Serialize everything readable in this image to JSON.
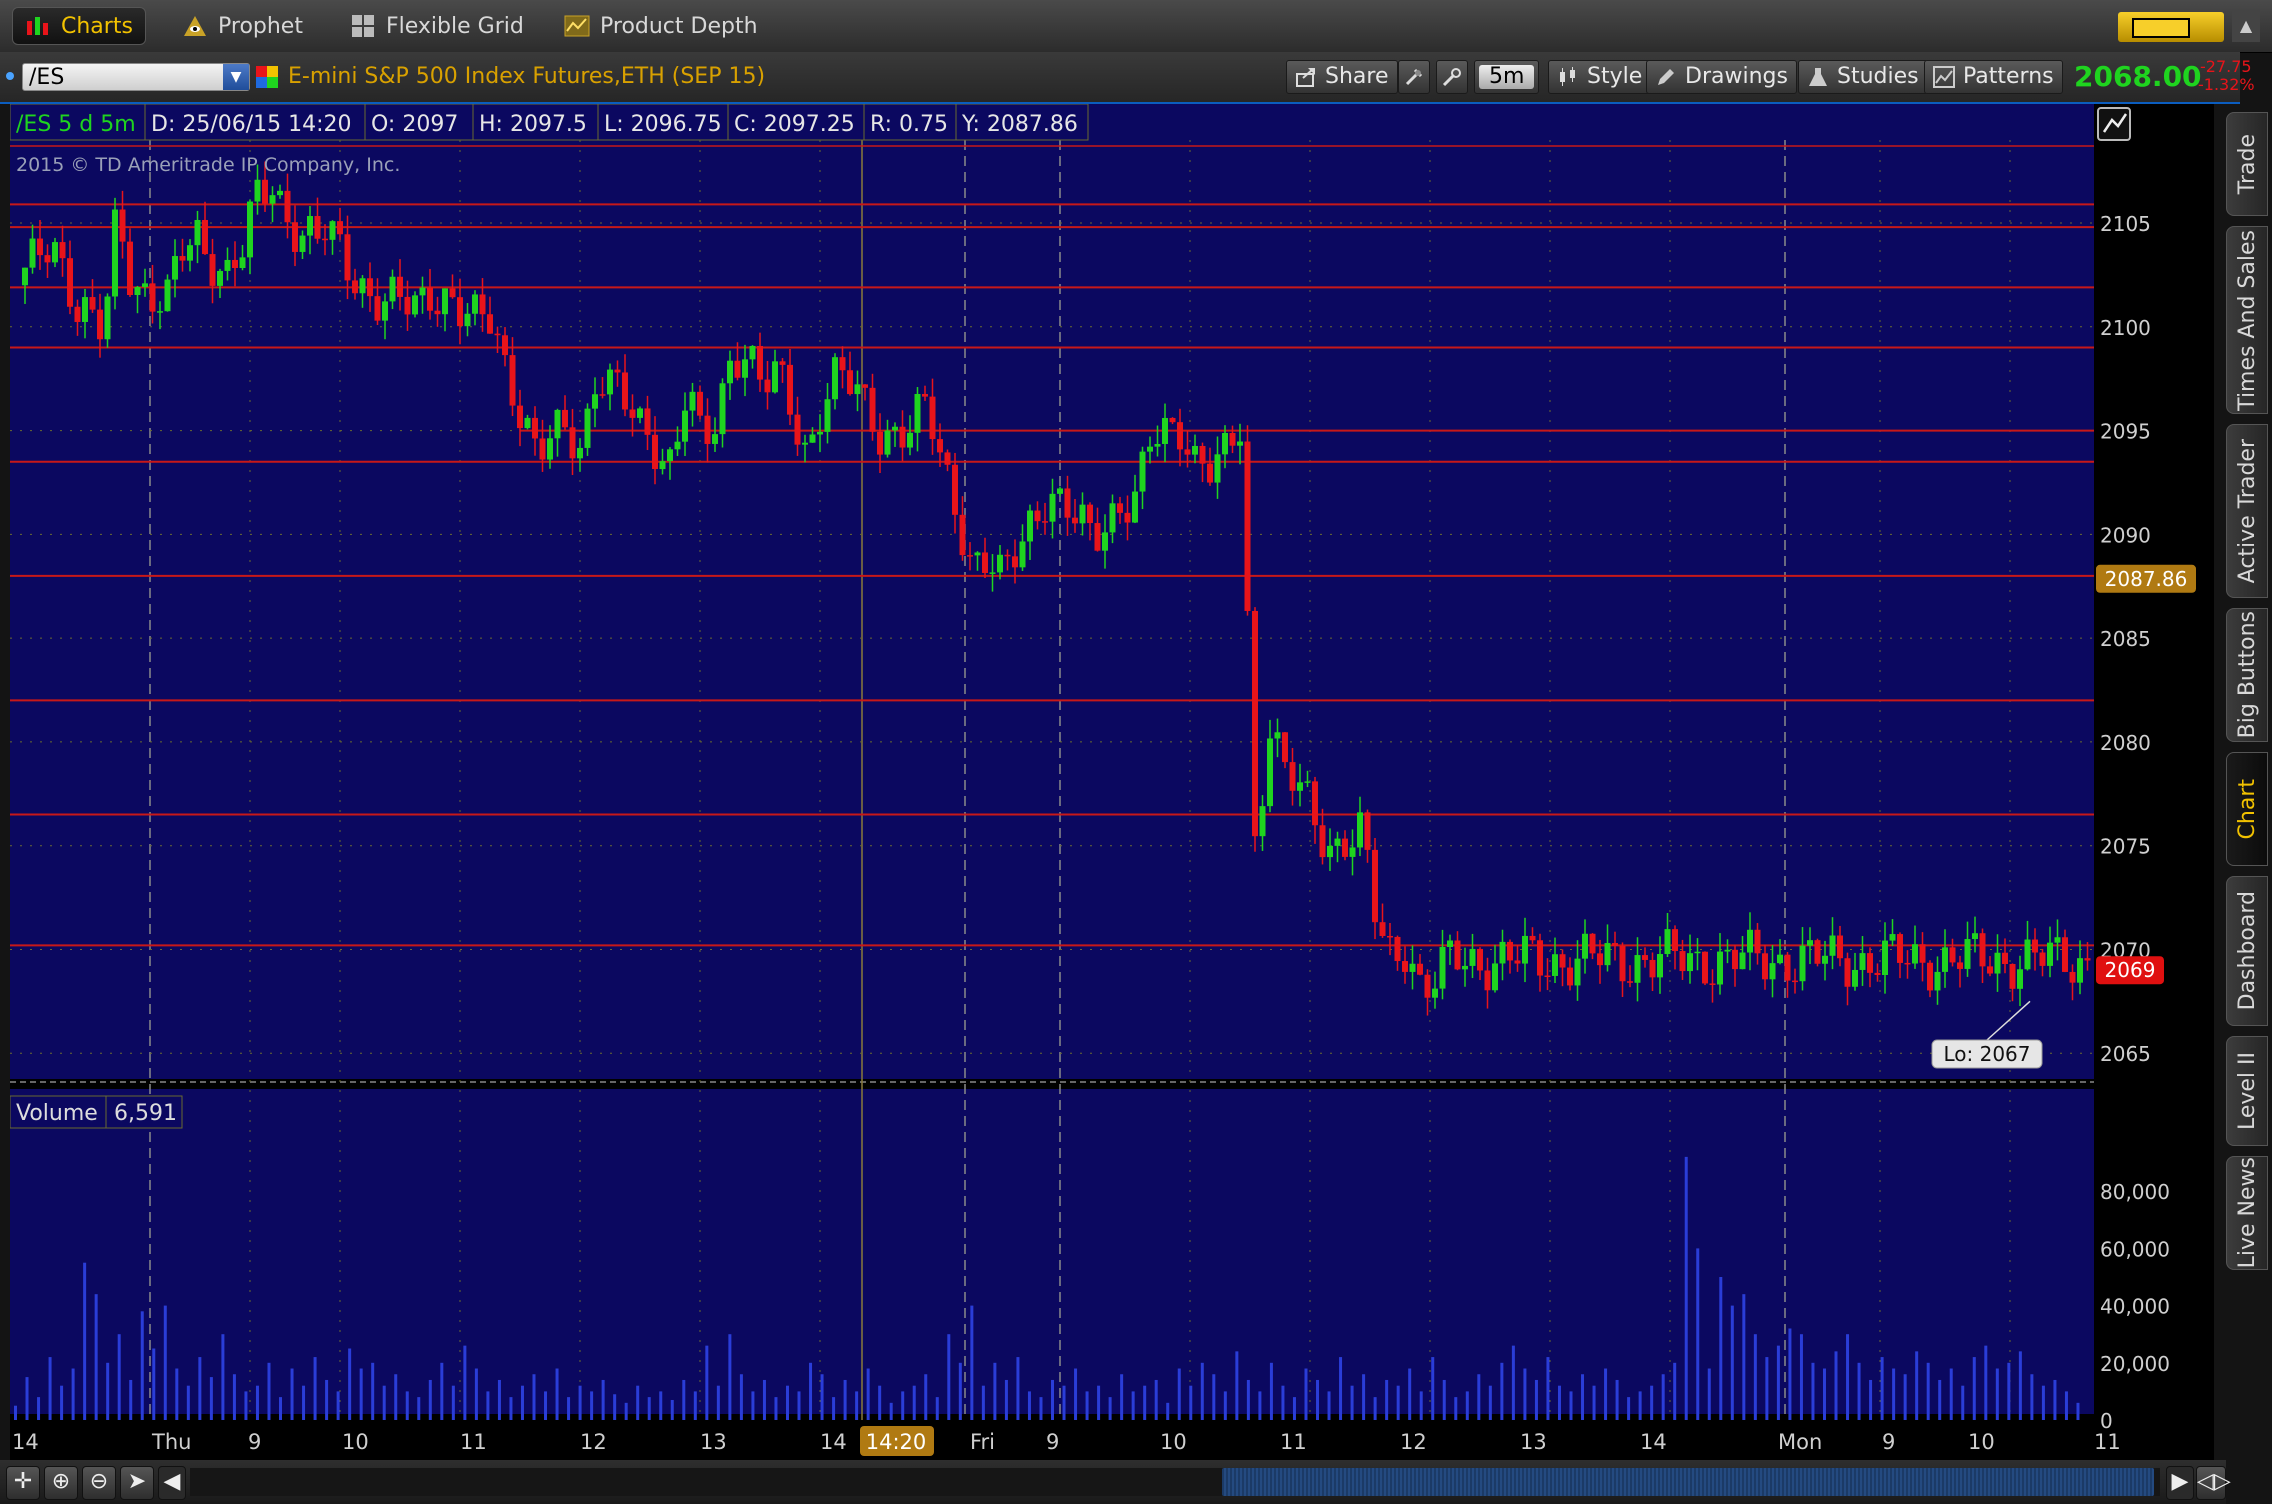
{
  "top_nav": [
    {
      "label": "Charts",
      "icon": "chart-bars-icon"
    },
    {
      "label": "Prophet",
      "icon": "prophet-eye-icon"
    },
    {
      "label": "Flexible Grid",
      "icon": "grid-icon"
    },
    {
      "label": "Product Depth",
      "icon": "depth-chart-icon"
    }
  ],
  "symbol_bar": {
    "symbol": "/ES",
    "description": "E-mini S&P 500 Index Futures,ETH (SEP 15)",
    "share_label": "Share",
    "aggregation_label": "5m",
    "style_label": "Style",
    "drawings_label": "Drawings",
    "studies_label": "Studies",
    "patterns_label": "Patterns",
    "last_price": "2068.00",
    "net_change": "-27.75",
    "pct_change": "-1.32%"
  },
  "info_bar": {
    "cells": [
      "/ES 5 d 5m",
      "D: 25/06/15 14:20",
      "O: 2097",
      "H: 2097.5",
      "L: 2096.75",
      "C: 2097.25",
      "R: 0.75",
      "Y: 2087.86"
    ]
  },
  "copyright": "2015 © TD Ameritrade IP Company, Inc.",
  "price_labels": {
    "y_marker": "2087.86",
    "last_marker": "2069",
    "low_callout": "Lo: 2067"
  },
  "volume_header": {
    "label": "Volume",
    "value": "6,591"
  },
  "time_labels": [
    "14",
    "Thu",
    "9",
    "10",
    "11",
    "12",
    "13",
    "14",
    "14:20",
    "Fri",
    "9",
    "10",
    "11",
    "12",
    "13",
    "14",
    "Mon",
    "9",
    "10",
    "11"
  ],
  "side_tabs": [
    "Trade",
    "Times And Sales",
    "Active Trader",
    "Big Buttons",
    "Chart",
    "Dashboard",
    "Level II",
    "Live News"
  ],
  "active_side_tab": "Chart",
  "colors": {
    "chart_bg": "#0b0860",
    "up": "#1fd41f",
    "down": "#e8141a",
    "level_line": "#c81818",
    "volume": "#2a3dd8",
    "accent": "#f2c200",
    "grid": "#6a6a30"
  },
  "chart_data": {
    "type": "candlestick",
    "price_axis": {
      "ticks": [
        2065,
        2070,
        2075,
        2080,
        2085,
        2090,
        2095,
        2100,
        2105
      ],
      "range": [
        2064,
        2109
      ]
    },
    "volume_axis": {
      "ticks": [
        "0",
        "20,000",
        "40,000",
        "60,000",
        "80,000"
      ],
      "range": [
        0,
        100000
      ]
    },
    "horizontal_levels": [
      2105.9,
      2104.8,
      2101.9,
      2099,
      2095,
      2093.5,
      2088,
      2082,
      2076.5,
      2070.2
    ],
    "price_path": [
      [
        0,
        2102
      ],
      [
        18,
        2103.5
      ],
      [
        30,
        2104.5
      ],
      [
        42,
        2103
      ],
      [
        55,
        2101
      ],
      [
        70,
        2100
      ],
      [
        82,
        2099.5
      ],
      [
        95,
        2105.5
      ],
      [
        110,
        2102.5
      ],
      [
        128,
        2101.5
      ],
      [
        145,
        2101
      ],
      [
        160,
        2103.5
      ],
      [
        175,
        2104.5
      ],
      [
        190,
        2103.5
      ],
      [
        205,
        2102.5
      ],
      [
        220,
        2103.5
      ],
      [
        235,
        2106
      ],
      [
        250,
        2107
      ],
      [
        265,
        2105.5
      ],
      [
        280,
        2104.5
      ],
      [
        295,
        2104
      ],
      [
        305,
        2104.5
      ],
      [
        320,
        2103.5
      ],
      [
        335,
        2102.5
      ],
      [
        350,
        2101.5
      ],
      [
        365,
        2101
      ],
      [
        380,
        2101
      ],
      [
        395,
        2101
      ],
      [
        410,
        2102
      ],
      [
        425,
        2101.5
      ],
      [
        440,
        2100.5
      ],
      [
        455,
        2100
      ],
      [
        470,
        2100.5
      ],
      [
        485,
        2098
      ],
      [
        500,
        2096
      ],
      [
        515,
        2093.5
      ],
      [
        530,
        2094.5
      ],
      [
        545,
        2095
      ],
      [
        560,
        2094.5
      ],
      [
        575,
        2098
      ],
      [
        590,
        2097
      ],
      [
        605,
        2096
      ],
      [
        620,
        2095
      ],
      [
        635,
        2094.5
      ],
      [
        650,
        2093.5
      ],
      [
        665,
        2097
      ],
      [
        680,
        2094
      ],
      [
        695,
        2095.5
      ],
      [
        710,
        2099
      ],
      [
        725,
        2099
      ],
      [
        740,
        2097
      ],
      [
        755,
        2097.5
      ],
      [
        770,
        2096
      ],
      [
        785,
        2094
      ],
      [
        800,
        2096.5
      ],
      [
        815,
        2097.5
      ],
      [
        830,
        2097
      ],
      [
        845,
        2096
      ],
      [
        860,
        2095
      ],
      [
        875,
        2095
      ],
      [
        890,
        2095
      ],
      [
        905,
        2096
      ],
      [
        920,
        2093.5
      ],
      [
        935,
        2091.5
      ],
      [
        950,
        2088.5
      ],
      [
        965,
        2088.5
      ],
      [
        980,
        2087.5
      ],
      [
        995,
        2089.5
      ],
      [
        1010,
        2091
      ],
      [
        1025,
        2092
      ],
      [
        1040,
        2091
      ],
      [
        1055,
        2090.5
      ],
      [
        1070,
        2090
      ],
      [
        1085,
        2091
      ],
      [
        1100,
        2091.5
      ],
      [
        1115,
        2091.5
      ],
      [
        1130,
        2094.5
      ],
      [
        1145,
        2095
      ],
      [
        1160,
        2095.5
      ],
      [
        1175,
        2093.5
      ],
      [
        1190,
        2093
      ],
      [
        1205,
        2093.5
      ],
      [
        1220,
        2095.5
      ],
      [
        1232,
        2075
      ],
      [
        1248,
        2081
      ],
      [
        1262,
        2078.5
      ],
      [
        1278,
        2077.5
      ],
      [
        1295,
        2076
      ],
      [
        1310,
        2075
      ],
      [
        1325,
        2075.5
      ],
      [
        1340,
        2075.5
      ],
      [
        1355,
        2071
      ],
      [
        1370,
        2069.5
      ],
      [
        1385,
        2070.5
      ],
      [
        1400,
        2068
      ],
      [
        1415,
        2068.5
      ],
      [
        1430,
        2069.5
      ]
    ],
    "volume_values": [
      5,
      15,
      8,
      22,
      12,
      18,
      55,
      44,
      20,
      30,
      14,
      38,
      25,
      40,
      18,
      12,
      22,
      15,
      30,
      16,
      10,
      12,
      20,
      8,
      18,
      12,
      22,
      14,
      10,
      25,
      18,
      20,
      12,
      16,
      10,
      8,
      14,
      20,
      12,
      26,
      18,
      10,
      14,
      8,
      12,
      16,
      10,
      18,
      8,
      12,
      10,
      14,
      9,
      6,
      12,
      8,
      10,
      7,
      14,
      10,
      26,
      12,
      30,
      16,
      10,
      14,
      8,
      12,
      10,
      20,
      16,
      8,
      14,
      10,
      18,
      12,
      6,
      10,
      12,
      16,
      8,
      30,
      20,
      40,
      12,
      20,
      14,
      22,
      10,
      8,
      14,
      12,
      18,
      10,
      12,
      8,
      16,
      10,
      12,
      14,
      6,
      18,
      12,
      20,
      16,
      10,
      24,
      14,
      10,
      20,
      12,
      8,
      18,
      14,
      10,
      22,
      12,
      16,
      8,
      14,
      12,
      18,
      10,
      22,
      14,
      8,
      10,
      16,
      12,
      20,
      26,
      18,
      14,
      22,
      12,
      10,
      16,
      12,
      18,
      14,
      8,
      10,
      12,
      16,
      20,
      92,
      60,
      18,
      50,
      40,
      44,
      30,
      22,
      26,
      32,
      30,
      20,
      18,
      24,
      30,
      20,
      14,
      22,
      18,
      16,
      24,
      20,
      14,
      18,
      12,
      22,
      26,
      18,
      20,
      24,
      16,
      12,
      14,
      10,
      6
    ]
  }
}
